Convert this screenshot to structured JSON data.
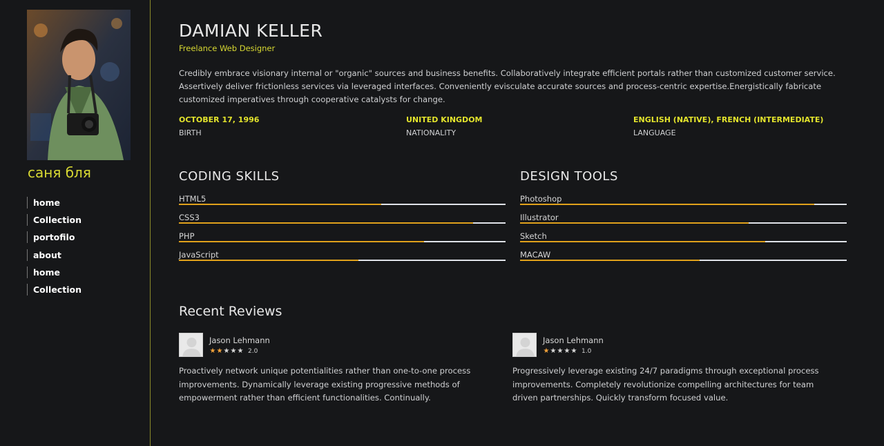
{
  "profile": {
    "name": "DAMIAN KELLER",
    "role": "Freelance Web Designer",
    "bio": "Credibly embrace visionary internal or \"organic\" sources and business benefits. Collaboratively integrate efficient portals rather than customized customer service. Assertively deliver frictionless services via leveraged interfaces. Conveniently evisculate accurate sources and process-centric expertise.Energistically fabricate customized imperatives through cooperative catalysts for change.",
    "facts": [
      {
        "value": "OCTOBER 17, 1996",
        "label": "BIRTH"
      },
      {
        "value": "UNITED KINGDOM",
        "label": "NATIONALITY"
      },
      {
        "value": "ENGLISH (NATIVE), FRENCH (INTERMEDIATE)",
        "label": "LANGUAGE"
      }
    ]
  },
  "sidebar": {
    "username": "саня бля",
    "nav": [
      "home",
      "Collection",
      "portofilo",
      "about",
      "home",
      "Collection"
    ]
  },
  "coding": {
    "title": "CODING SKILLS",
    "items": [
      {
        "name": "HTML5",
        "level": 0.62
      },
      {
        "name": "CSS3",
        "level": 0.9
      },
      {
        "name": "PHP",
        "level": 0.75
      },
      {
        "name": "JavaScript",
        "level": 0.55
      }
    ]
  },
  "design": {
    "title": "DESIGN TOOLS",
    "items": [
      {
        "name": "Photoshop",
        "level": 0.9
      },
      {
        "name": "Illustrator",
        "level": 0.7
      },
      {
        "name": "Sketch",
        "level": 0.75
      },
      {
        "name": "MACAW",
        "level": 0.55
      }
    ]
  },
  "reviews": {
    "title": "Recent Reviews",
    "items": [
      {
        "name": "Jason Lehmann",
        "rating": 2,
        "score": "2.0",
        "text": "Proactively network unique potentialities rather than one-to-one process improvements. Dynamically leverage existing progressive methods of empowerment rather than efficient functionalities. Continually."
      },
      {
        "name": "Jason Lehmann",
        "rating": 1,
        "score": "1.0",
        "text": "Progressively leverage existing 24/7 paradigms through exceptional process improvements. Completely revolutionize compelling architectures for team driven partnerships. Quickly transform focused value."
      }
    ]
  },
  "colors": {
    "accent": "#d7d832",
    "bar_fill": "#e0a11b",
    "bar_track": "#dfe2e8",
    "star_on": "#f2a23a"
  }
}
